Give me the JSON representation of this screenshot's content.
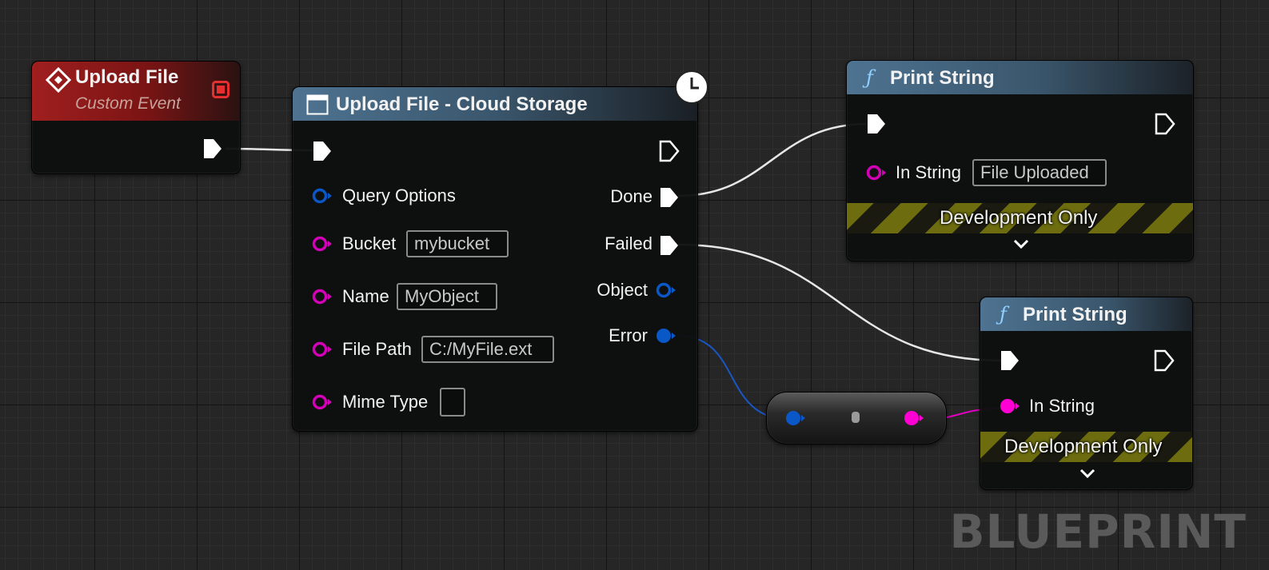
{
  "watermark": "BLUEPRINT",
  "nodes": {
    "upload_event": {
      "title": "Upload File",
      "subtitle": "Custom Event",
      "header_color": "#8b1a1a"
    },
    "upload_cloud": {
      "title": "Upload File - Cloud Storage",
      "inputs": {
        "query_options": "Query Options",
        "bucket": {
          "label": "Bucket",
          "value": "mybucket"
        },
        "name": {
          "label": "Name",
          "value": "MyObject"
        },
        "file_path": {
          "label": "File Path",
          "value": "C:/MyFile.ext"
        },
        "mime_type": {
          "label": "Mime Type",
          "value": ""
        }
      },
      "outputs": {
        "done": "Done",
        "failed": "Failed",
        "object": "Object",
        "error": "Error"
      },
      "latent_icon": "clock-icon"
    },
    "print_1": {
      "title": "Print String",
      "in_string_label": "In String",
      "in_string_value": "File Uploaded",
      "dev_label": "Development Only"
    },
    "print_2": {
      "title": "Print String",
      "in_string_label": "In String",
      "dev_label": "Development Only"
    }
  },
  "colors": {
    "event_header": "#8b1a1a",
    "function_header": "#3c5366",
    "string_pin": "#ff00d4",
    "struct_pin": "#0a57c8",
    "exec_pin": "#ffffff",
    "dev_stripe": "#6d6d10"
  }
}
